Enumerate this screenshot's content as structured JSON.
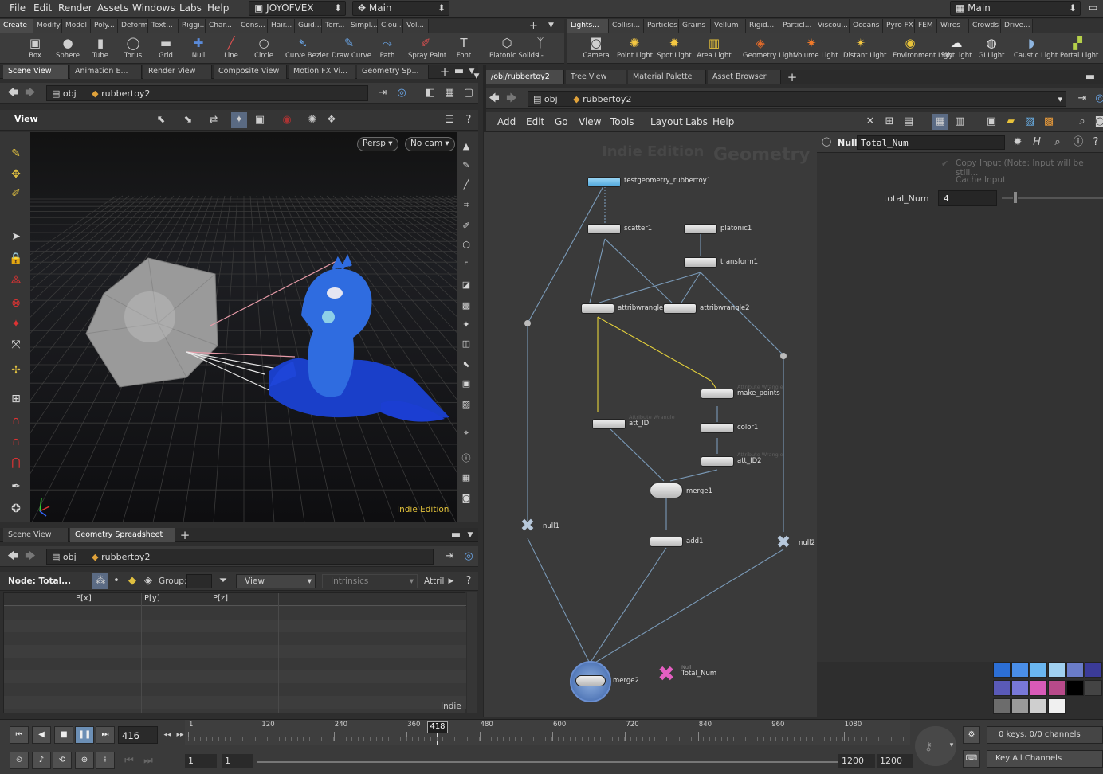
{
  "menu": {
    "items": [
      "File",
      "Edit",
      "Render",
      "Assets",
      "Windows",
      "Labs",
      "Help"
    ],
    "project": "JOYOFVEX",
    "desktop": "Main",
    "right_desktop": "Main"
  },
  "shelf": {
    "left_tabs": [
      "Create",
      "Modify",
      "Model",
      "Poly...",
      "Deform",
      "Text...",
      "Riggi...",
      "Char...",
      "Cons...",
      "Hair...",
      "Guid...",
      "Terr...",
      "Simpl...",
      "Clou...",
      "Vol..."
    ],
    "left_tools": [
      {
        "label": "Box",
        "icon": "box-icon"
      },
      {
        "label": "Sphere",
        "icon": "sphere-icon"
      },
      {
        "label": "Tube",
        "icon": "tube-icon"
      },
      {
        "label": "Torus",
        "icon": "torus-icon"
      },
      {
        "label": "Grid",
        "icon": "grid-icon"
      },
      {
        "label": "Null",
        "icon": "null-icon"
      },
      {
        "label": "Line",
        "icon": "line-icon"
      },
      {
        "label": "Circle",
        "icon": "circle-icon"
      },
      {
        "label": "Curve Bezier",
        "icon": "curve-bezier-icon"
      },
      {
        "label": "Draw Curve",
        "icon": "draw-curve-icon"
      },
      {
        "label": "Path",
        "icon": "path-icon"
      },
      {
        "label": "Spray Paint",
        "icon": "spray-paint-icon"
      },
      {
        "label": "Font",
        "icon": "font-icon"
      },
      {
        "label": "Platonic Solids",
        "icon": "platonic-solids-icon"
      },
      {
        "label": "L-",
        "icon": "lsystem-icon"
      }
    ],
    "right_tabs": [
      "Lights...",
      "Collisi...",
      "Particles",
      "Grains",
      "Vellum",
      "Rigid...",
      "Particl...",
      "Viscou...",
      "Oceans",
      "Pyro FX",
      "FEM",
      "Wires",
      "Crowds",
      "Drive..."
    ],
    "right_tools": [
      {
        "label": "Camera",
        "icon": "camera-icon"
      },
      {
        "label": "Point Light",
        "icon": "point-light-icon"
      },
      {
        "label": "Spot Light",
        "icon": "spot-light-icon"
      },
      {
        "label": "Area Light",
        "icon": "area-light-icon"
      },
      {
        "label": "Geometry Light",
        "icon": "geometry-light-icon"
      },
      {
        "label": "Volume Light",
        "icon": "volume-light-icon"
      },
      {
        "label": "Distant Light",
        "icon": "distant-light-icon"
      },
      {
        "label": "Environment Light",
        "icon": "environment-light-icon"
      },
      {
        "label": "Sky Light",
        "icon": "sky-light-icon"
      },
      {
        "label": "GI Light",
        "icon": "gi-light-icon"
      },
      {
        "label": "Caustic Light",
        "icon": "caustic-light-icon"
      },
      {
        "label": "Portal Light",
        "icon": "portal-light-icon"
      }
    ]
  },
  "left_pane": {
    "tabs": [
      "Scene View",
      "Animation E...",
      "Render View",
      "Composite View",
      "Motion FX Vi...",
      "Geometry Sp..."
    ],
    "path": [
      "obj",
      "rubbertoy2"
    ],
    "view_label": "View",
    "persp": "Persp",
    "cam": "No cam",
    "watermark": "Indie Edition"
  },
  "sheet": {
    "tabs": [
      "Scene View",
      "Geometry Spreadsheet"
    ],
    "path": [
      "obj",
      "rubbertoy2"
    ],
    "node_label": "Node: Total...",
    "group_label": "Group:",
    "view_label": "View",
    "intrinsics": "Intrinsics",
    "attrib": "Attril",
    "columns": [
      "",
      "P[x]",
      "P[y]",
      "P[z]"
    ],
    "footer": "Indie"
  },
  "network": {
    "tabs": [
      "/obj/rubbertoy2",
      "Tree View",
      "Material Palette",
      "Asset Browser"
    ],
    "path": [
      "obj",
      "rubbertoy2"
    ],
    "menu": [
      "Add",
      "Edit",
      "Go",
      "View",
      "Tools",
      "Layout",
      "Labs",
      "Help"
    ],
    "watermark1": "Indie Edition",
    "watermark2": "Geometry",
    "nodes": [
      {
        "name": "testgeometry_rubbertoy1",
        "sub": ""
      },
      {
        "name": "scatter1",
        "sub": ""
      },
      {
        "name": "platonic1",
        "sub": ""
      },
      {
        "name": "transform1",
        "sub": ""
      },
      {
        "name": "attribwrangle1",
        "sub": ""
      },
      {
        "name": "attribwrangle2",
        "sub": ""
      },
      {
        "name": "make_points",
        "sub": "Attribute Wrangle"
      },
      {
        "name": "att_ID",
        "sub": "Attribute Wrangle"
      },
      {
        "name": "color1",
        "sub": ""
      },
      {
        "name": "att_ID2",
        "sub": "Attribute Wrangle"
      },
      {
        "name": "merge1",
        "sub": ""
      },
      {
        "name": "add1",
        "sub": ""
      },
      {
        "name": "null1",
        "sub": ""
      },
      {
        "name": "null2",
        "sub": ""
      },
      {
        "name": "merge2",
        "sub": ""
      },
      {
        "name": "Total_Num",
        "sub": "Null"
      }
    ]
  },
  "params": {
    "type": "Null",
    "name": "Total_Num",
    "copy_input": "Copy Input (Note: Input will be still...",
    "cache_input": "Cache Input",
    "total_num_label": "total_Num",
    "total_num_value": "4"
  },
  "timeline": {
    "frame": "416",
    "marker": "418",
    "ticks": [
      "1",
      "120",
      "240",
      "360",
      "480",
      "600",
      "720",
      "840",
      "960",
      "1080"
    ],
    "start": "1",
    "start2": "1",
    "end": "1200",
    "end2": "1200",
    "keys": "0 keys, 0/0 channels",
    "key_all": "Key All Channels"
  }
}
